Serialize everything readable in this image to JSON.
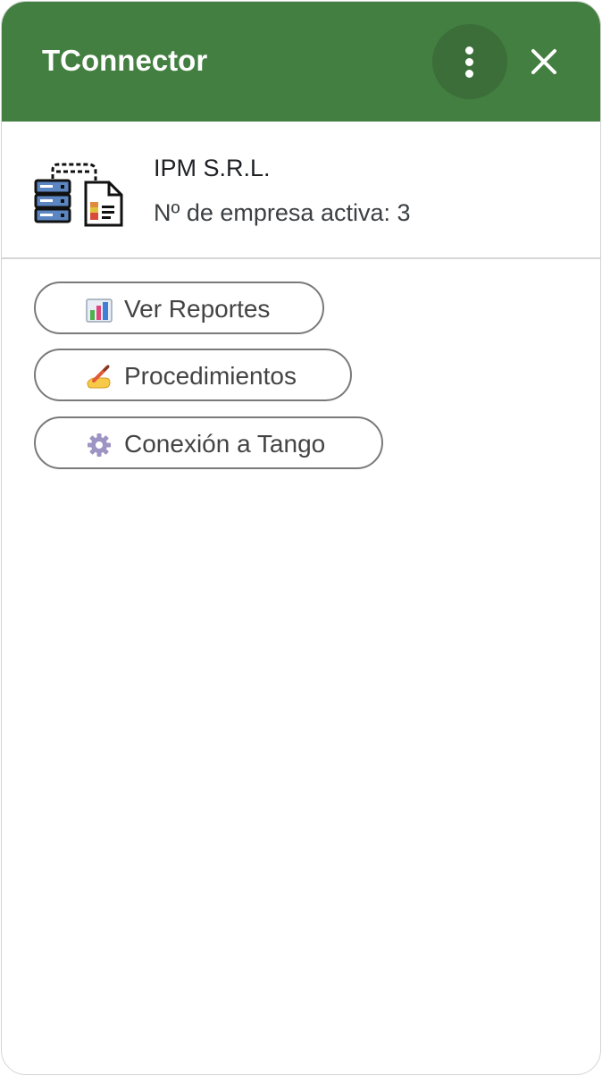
{
  "header": {
    "title": "TConnector",
    "menu_icon": "more-vert-icon",
    "close_icon": "close-icon",
    "color": "#437f40"
  },
  "company": {
    "name": "IPM S.R.L.",
    "active_label": "Nº de empresa activa: 3",
    "logo_icon": "server-document-connection-icon"
  },
  "actions": [
    {
      "label": "Ver Reportes",
      "icon": "bar-chart-icon"
    },
    {
      "label": "Procedimientos",
      "icon": "writing-hand-icon"
    },
    {
      "label": "Conexión a Tango",
      "icon": "gear-icon"
    }
  ]
}
